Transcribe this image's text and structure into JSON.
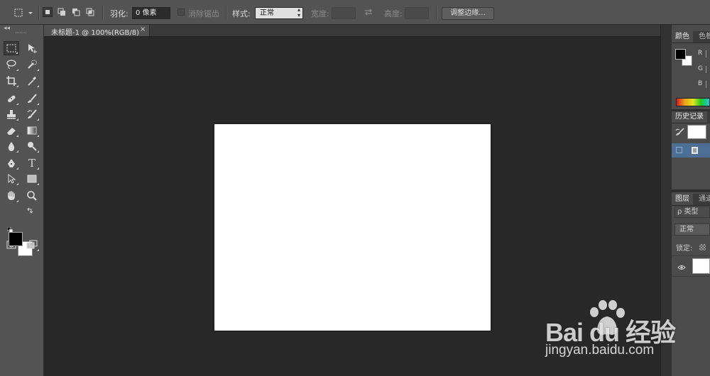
{
  "options_bar": {
    "feather_label": "羽化:",
    "feather_value": "0 像素",
    "antialias_label": "消除锯齿",
    "style_label": "样式:",
    "style_value": "正常",
    "width_label": "宽度:",
    "height_label": "高度:",
    "refine_edge_button": "调整边缘..."
  },
  "document": {
    "tab_title": "未标题-1 @ 100%(RGB/8)",
    "tab_close": "×",
    "canvas_color": "#ffffff"
  },
  "toolbar": {
    "collapse_glyph": "◂◂",
    "type_tool_glyph": "T",
    "foreground_color": "#000000",
    "background_color": "#ffffff",
    "tools": [
      "rectangular-marquee",
      "move",
      "lasso",
      "quick-selection",
      "crop",
      "eyedropper",
      "spot-healing-brush",
      "brush",
      "clone-stamp",
      "history-brush",
      "eraser",
      "gradient",
      "blur",
      "dodge",
      "pen",
      "type",
      "path-selection",
      "rectangle",
      "hand",
      "zoom"
    ]
  },
  "panels": {
    "color_tab": "颜色",
    "swatches_tab": "色板",
    "channel_r": "R",
    "channel_g": "G",
    "channel_b": "B",
    "history_tab": "历史记录",
    "layers_tab": "图层",
    "channels_tab": "通道",
    "layer_filter": "ρ 类型",
    "blend_mode": "正常",
    "lock_label": "锁定:"
  },
  "watermark": {
    "brand": "Bai du 经验",
    "url": "jingyan.baidu.com"
  }
}
